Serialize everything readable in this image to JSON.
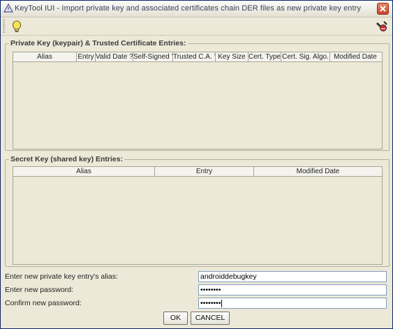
{
  "window": {
    "title": "KeyTool IUI - Import private key and associated certificates chain DER files as new private key entry"
  },
  "toolbar": {
    "left_icon": "lightbulb-icon",
    "right_icon": "tool-icon"
  },
  "keypair_panel": {
    "title": "Private Key (keypair) & Trusted Certificate Entries:",
    "columns": [
      "Alias",
      "Entry",
      "Valid Date ?",
      "Self-Signed ?",
      "Trusted C.A. ?",
      "Key Size",
      "Cert. Type",
      "Cert. Sig. Algo.",
      "Modified Date"
    ]
  },
  "secret_panel": {
    "title": "Secret Key (shared key) Entries:",
    "columns": [
      "Alias",
      "Entry",
      "Modified Date"
    ]
  },
  "form": {
    "alias_label": "Enter new private key entry's alias:",
    "alias_value": "androiddebugkey",
    "password_label": "Enter new password:",
    "password_value": "••••••••",
    "confirm_label": "Confirm new password:",
    "confirm_value": "••••••••"
  },
  "buttons": {
    "ok": "OK",
    "cancel": "CANCEL"
  },
  "colors": {
    "background": "#ECE9D8",
    "field_border": "#7F9DB9",
    "close_button": "#C7452A"
  }
}
